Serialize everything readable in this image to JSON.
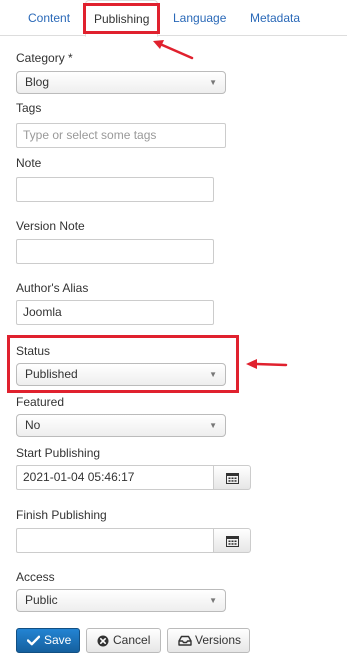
{
  "tabs": [
    {
      "label": "Content"
    },
    {
      "label": "Publishing"
    },
    {
      "label": "Language"
    },
    {
      "label": "Metadata"
    }
  ],
  "form": {
    "category": {
      "label": "Category *",
      "value": "Blog"
    },
    "tags": {
      "label": "Tags",
      "placeholder": "Type or select some tags"
    },
    "note": {
      "label": "Note",
      "value": ""
    },
    "version_note": {
      "label": "Version Note",
      "value": ""
    },
    "authors_alias": {
      "label": "Author's Alias",
      "value": "Joomla"
    },
    "status": {
      "label": "Status",
      "value": "Published"
    },
    "featured": {
      "label": "Featured",
      "value": "No"
    },
    "start_publishing": {
      "label": "Start Publishing",
      "value": "2021-01-04 05:46:17"
    },
    "finish_publishing": {
      "label": "Finish Publishing",
      "value": ""
    },
    "access": {
      "label": "Access",
      "value": "Public"
    }
  },
  "buttons": {
    "save": "Save",
    "cancel": "Cancel",
    "versions": "Versions"
  },
  "icons": {
    "calendar": "calendar-icon",
    "check": "check-icon",
    "cancel": "x-circle-icon",
    "versions": "archive-icon"
  },
  "colors": {
    "link": "#2a69b8",
    "primary": "#1b74bf",
    "highlight": "#e0212e"
  }
}
